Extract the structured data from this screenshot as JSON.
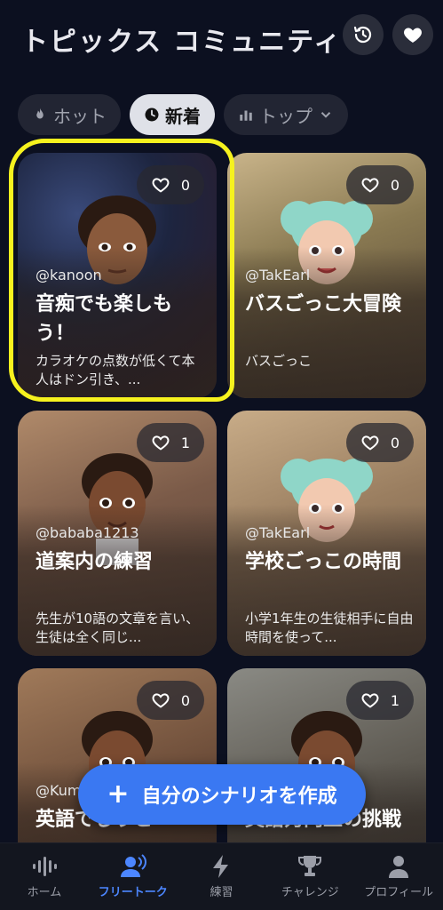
{
  "header": {
    "title_left": "トピックス",
    "title_right": "コミュニティ",
    "history_icon": "history-icon",
    "favorite_icon": "heart-icon"
  },
  "filters": [
    {
      "label": "ホット",
      "icon": "flame-icon",
      "active": false
    },
    {
      "label": "新着",
      "icon": "clock-icon",
      "active": true
    },
    {
      "label": "トップ",
      "icon": "bar-chart-icon",
      "active": false
    }
  ],
  "cards": [
    {
      "likes": "0",
      "user": "@kanoon",
      "title": "音痴でも楽しもう！",
      "desc": "カラオケの点数が低くて本人はドン引き、..."
    },
    {
      "likes": "0",
      "user": "@TakEarl",
      "title": "バスごっこ大冒険",
      "desc": "バスごっこ"
    },
    {
      "likes": "1",
      "user": "@bababa1213",
      "title": "道案内の練習",
      "desc": "先生が10語の文章を言い、生徒は全く同じ..."
    },
    {
      "likes": "0",
      "user": "@TakEarl",
      "title": "学校ごっこの時間",
      "desc": "小学1年生の生徒相手に自由時間を使って..."
    },
    {
      "likes": "0",
      "user": "@KumiMishima4492",
      "title": "英語でしりと",
      "desc": ""
    },
    {
      "likes": "1",
      "user": "",
      "title": "英語力向上の挑戦",
      "desc": ""
    }
  ],
  "create_button": {
    "label": "自分のシナリオを作成",
    "icon": "plus-icon"
  },
  "bottom_nav": [
    {
      "label": "ホーム",
      "icon": "waveform-icon",
      "active": false
    },
    {
      "label": "フリートーク",
      "icon": "voice-user-icon",
      "active": true
    },
    {
      "label": "練習",
      "icon": "lightning-icon",
      "active": false
    },
    {
      "label": "チャレンジ",
      "icon": "trophy-icon",
      "active": false
    },
    {
      "label": "プロフィール",
      "icon": "person-icon",
      "active": false
    }
  ],
  "colors": {
    "accent": "#3a78f2",
    "nav_active": "#4c86ff",
    "highlight": "#f6f21e",
    "background": "#0c1020"
  }
}
